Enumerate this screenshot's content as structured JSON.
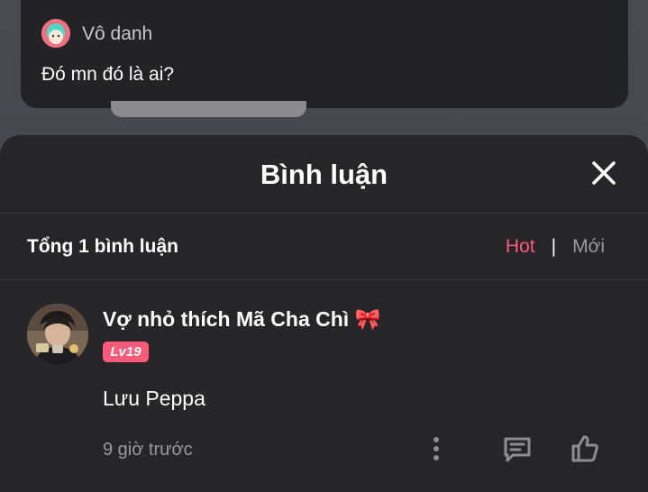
{
  "top_card": {
    "author": "Vô danh",
    "message": "Đó mn đó là ai?"
  },
  "sheet": {
    "title": "Bình luận",
    "total_label": "Tổng 1 bình luận",
    "sort": {
      "hot_label": "Hot",
      "separator": "|",
      "new_label": "Mới",
      "active": "Hot"
    }
  },
  "comment": {
    "username": "Vợ nhỏ thích Mã Cha Chì 🎀",
    "level": "Lv19",
    "text": "Lưu Peppa",
    "time": "9 giờ trước"
  },
  "icons": {
    "close": "close-icon",
    "more": "more-vertical-icon",
    "reply": "reply-comment-icon",
    "like": "thumbs-up-icon"
  },
  "colors": {
    "accent": "#ff5a7a",
    "sheet_bg": "#262628",
    "muted_text": "#9a9a9e"
  }
}
